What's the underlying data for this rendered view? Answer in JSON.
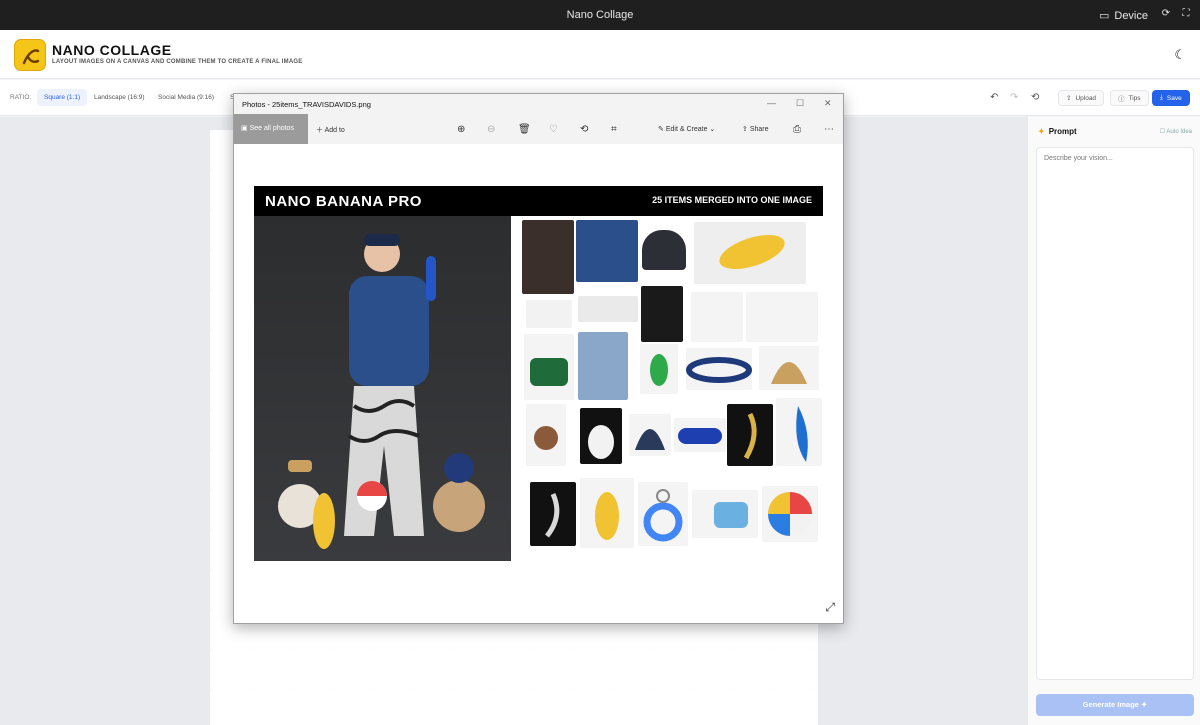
{
  "titlebar": {
    "title": "Nano Collage",
    "device": "Device"
  },
  "header": {
    "title": "NANO COLLAGE",
    "subtitle": "LAYOUT IMAGES ON A CANVAS AND COMBINE THEM TO CREATE A FINAL IMAGE"
  },
  "toolbar": {
    "ratio_label": "RATIO:",
    "ratios": [
      "Square (1:1)",
      "Landscape (16:9)",
      "Social Media (9:16)",
      "S"
    ],
    "upload": "Upload",
    "tips": "Tips",
    "save": "Save"
  },
  "sidebar": {
    "prompt_title": "Prompt",
    "auto_idea": "Auto Idea",
    "placeholder": "Describe your vision...",
    "generate": "Generate Image"
  },
  "photos": {
    "window_title": "Photos - 25items_TRAVISDAVIDS.png",
    "see_all": "See all photos",
    "add_to": "Add to",
    "edit_create": "Edit & Create",
    "share": "Share",
    "image_title_left": "NANO BANANA PRO",
    "image_title_right": "25 ITEMS MERGED INTO ONE IMAGE"
  },
  "colors": {
    "accent": "#2563eb",
    "logo": "#f5c518"
  }
}
